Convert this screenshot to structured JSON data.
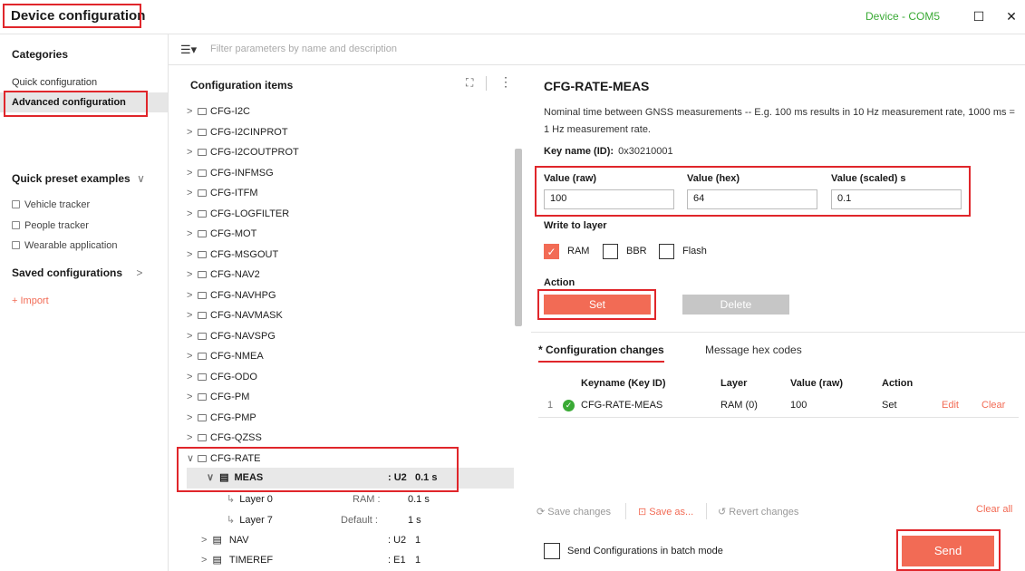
{
  "app": {
    "title": "Device configuration",
    "device": "Device - COM5",
    "maximize_glyph": "☐",
    "close_glyph": "✕"
  },
  "sidebar": {
    "categories_heading": "Categories",
    "items": [
      {
        "label": "Quick configuration",
        "active": false
      },
      {
        "label": "Advanced configuration",
        "active": true
      }
    ],
    "presets_heading": "Quick preset examples",
    "presets": [
      "Vehicle tracker",
      "People tracker",
      "Wearable application"
    ],
    "saved_heading": "Saved configurations",
    "import_label": "+ Import"
  },
  "filter": {
    "placeholder": "Filter parameters by name and description"
  },
  "tree": {
    "title": "Configuration items",
    "groups": [
      "CFG-I2C",
      "CFG-I2CINPROT",
      "CFG-I2COUTPROT",
      "CFG-INFMSG",
      "CFG-ITFM",
      "CFG-LOGFILTER",
      "CFG-MOT",
      "CFG-MSGOUT",
      "CFG-NAV2",
      "CFG-NAVHPG",
      "CFG-NAVMASK",
      "CFG-NAVSPG",
      "CFG-NMEA",
      "CFG-ODO",
      "CFG-PM",
      "CFG-PMP",
      "CFG-QZSS",
      "CFG-RATE"
    ],
    "expanded_item": {
      "name": "MEAS",
      "type": ": U2",
      "value": "0.1 s"
    },
    "layers": [
      {
        "name": "Layer 0",
        "layer": "RAM :",
        "value": "0.1 s"
      },
      {
        "name": "Layer 7",
        "layer": "Default :",
        "value": "1 s"
      }
    ],
    "siblings": [
      {
        "name": "NAV",
        "type": ": U2",
        "value": "1"
      },
      {
        "name": "TIMEREF",
        "type": ": E1",
        "value": "1"
      }
    ]
  },
  "detail": {
    "title": "CFG-RATE-MEAS",
    "description": "Nominal time between GNSS measurements -- E.g. 100 ms results in 10 Hz measurement rate, 1000 ms = 1 Hz measurement rate.",
    "key_label": "Key name (ID):",
    "key_value": "0x30210001",
    "fields": [
      {
        "label": "Value (raw)",
        "value": "100"
      },
      {
        "label": "Value (hex)",
        "value": "64"
      },
      {
        "label": "Value (scaled) s",
        "value": "0.1"
      }
    ],
    "write_layer_label": "Write to layer",
    "layers": [
      {
        "label": "RAM",
        "checked": true
      },
      {
        "label": "BBR",
        "checked": false
      },
      {
        "label": "Flash",
        "checked": false
      }
    ],
    "action_label": "Action",
    "set_label": "Set",
    "delete_label": "Delete"
  },
  "changes": {
    "tabs": [
      "* Configuration changes",
      "Message hex codes"
    ],
    "columns": [
      "Keyname (Key ID)",
      "Layer",
      "Value (raw)",
      "Action"
    ],
    "rows": [
      {
        "index": "1",
        "keyname": "CFG-RATE-MEAS",
        "layer": "RAM (0)",
        "value": "100",
        "action": "Set",
        "edit": "Edit",
        "clear": "Clear"
      }
    ],
    "save_changes": "Save changes",
    "save_as": "Save as...",
    "revert_changes": "Revert changes",
    "clear_all": "Clear all",
    "batch_label": "Send Configurations in batch mode",
    "send_label": "Send"
  },
  "colors": {
    "accent": "#f26b55",
    "highlight": "#e0262b",
    "status_ok": "#3aaa35"
  }
}
